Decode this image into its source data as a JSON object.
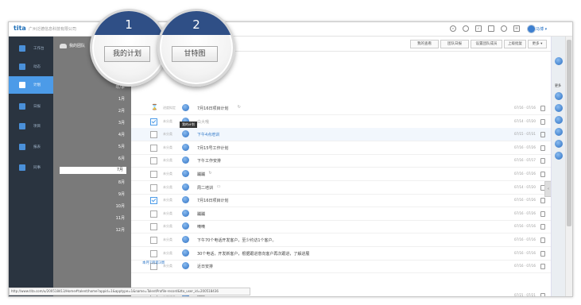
{
  "topbar": {
    "logo": "tita",
    "company": "广州泛德信息科技有限公司",
    "user_name": "马博 ▾",
    "icons": [
      "search-icon",
      "location-icon",
      "checklist-icon",
      "calendar-icon",
      "clock-icon",
      "mail-icon"
    ]
  },
  "nav": {
    "items": [
      {
        "label": "工作台",
        "icon": "desk-icon"
      },
      {
        "label": "动态",
        "icon": "chat-icon"
      },
      {
        "label": "计划",
        "icon": "list-icon"
      },
      {
        "label": "日报",
        "icon": "document-icon"
      },
      {
        "label": "项目",
        "icon": "project-icon"
      },
      {
        "label": "报表",
        "icon": "chart-icon"
      },
      {
        "label": "同事",
        "icon": "people-icon"
      }
    ],
    "active_index": 2
  },
  "months": {
    "header": "我的团队",
    "year": "年/季",
    "items": [
      "1月",
      "2月",
      "3月",
      "4月",
      "5月",
      "6月",
      "7月",
      "8月",
      "9月",
      "10月",
      "11月",
      "12月"
    ],
    "selected": "7月"
  },
  "toolbar": {
    "buttons": [
      "我的查看",
      "团队日报",
      "设置团队成员",
      "上级批复",
      "更多 ▾"
    ]
  },
  "callouts": [
    {
      "number": "1",
      "label": "我的计划"
    },
    {
      "number": "2",
      "label": "甘特图"
    }
  ],
  "sections": [
    {
      "title": "本月7月第2周",
      "rows": [
        {
          "status": "",
          "kind": "hourglass",
          "tag": "进度拟定",
          "title": "7月16日项目计划",
          "date": "07/16 · 07/16",
          "extra": "↻"
        },
        {
          "status": "",
          "kind": "checked",
          "tag": "未分类",
          "title": "白大哦",
          "date": "07/14 · 07/20",
          "muted": true
        },
        {
          "status": "未分类",
          "kind": "box",
          "tag": "",
          "title": "下午4点培训",
          "date": "07/15 · 07/31",
          "highlight": true,
          "link": true
        },
        {
          "status": "未分类",
          "kind": "box",
          "tag": "",
          "title": "7月15号工作计划",
          "date": "07/16 · 07/26"
        },
        {
          "status": "未分类",
          "kind": "box",
          "tag": "",
          "title": "下午工作安排",
          "date": "07/16 · 07/17"
        },
        {
          "status": "未分类",
          "kind": "box",
          "tag": "",
          "title": "蹦蹦",
          "date": "07/16 · 07/26",
          "extra": "↻"
        },
        {
          "status": "未分类",
          "kind": "box",
          "tag": "",
          "title": "周二培训",
          "date": "07/14 · 07/20",
          "extra": "▭"
        },
        {
          "status": "未分类",
          "kind": "checked",
          "tag": "",
          "title": "7月16日项目计划",
          "date": "07/16 · 07/26"
        },
        {
          "status": "未分类",
          "kind": "box",
          "tag": "",
          "title": "蹦蹦",
          "date": "07/16 · 07/26"
        },
        {
          "status": "未分类",
          "kind": "box",
          "tag": "",
          "title": "嘀嘀",
          "date": "07/16 · 07/16"
        },
        {
          "status": "未分类",
          "kind": "box",
          "tag": "",
          "title": "下午70个电话开发客户，至少约访1个客户。",
          "date": "07/16 · 07/16"
        },
        {
          "status": "未分类",
          "kind": "box",
          "tag": "",
          "title": "30个电话，开发新客户，根据跟进意向客户再次跟进，了解进展",
          "date": "07/16 · 07/16"
        },
        {
          "status": "未分类",
          "kind": "box",
          "tag": "",
          "title": "近日安排",
          "date": "07/16 · 07/16"
        }
      ]
    },
    {
      "title": "本月7月第3周",
      "rows": [
        {
          "status": "开发相关",
          "kind": "box",
          "tag": "",
          "title": "test",
          "date": "07/21 · 07/21"
        },
        {
          "status": "",
          "kind": "box",
          "tag": "",
          "title": "",
          "date": "07/24 · 07/26"
        }
      ]
    }
  ],
  "tooltip": "我的计划",
  "right_panel": {
    "label": "更多"
  },
  "statusbar": "http://www.tita.com/u/200518413/Home#talent/home?appid=1&apptype=1&name=TalentProfile-record&tto_user_id=200518436"
}
